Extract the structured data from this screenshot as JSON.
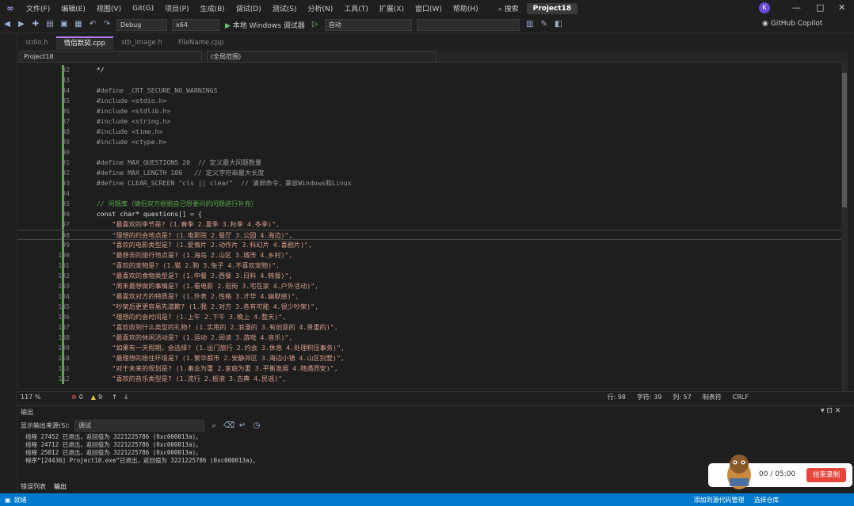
{
  "menu": [
    "文件(F)",
    "编辑(E)",
    "视图(V)",
    "Git(G)",
    "项目(P)",
    "生成(B)",
    "调试(D)",
    "测试(S)",
    "分析(N)",
    "工具(T)",
    "扩展(X)",
    "窗口(W)",
    "帮助(H)"
  ],
  "search_label": "搜索",
  "project_title": "Project18",
  "user_initial": "K",
  "toolbar": {
    "config": "Debug",
    "platform": "x64",
    "run_label": "本地 Windows 调试器",
    "auto": "自动",
    "copilot": "GitHub Copilot"
  },
  "tabs": [
    "stdio.h",
    "情侣默契.cpp",
    "stb_image.h",
    "FileName.cpp"
  ],
  "active_tab": 1,
  "nav": {
    "project": "Project18",
    "scope": "(全局范围)"
  },
  "code_lines": [
    {
      "n": "82",
      "t": "    */"
    },
    {
      "n": "83",
      "t": ""
    },
    {
      "n": "84",
      "t": "    #define _CRT_SECURE_NO_WARNINGS"
    },
    {
      "n": "85",
      "t": "    #include <stdio.h>"
    },
    {
      "n": "86",
      "t": "    #include <stdlib.h>"
    },
    {
      "n": "87",
      "t": "    #include <string.h>"
    },
    {
      "n": "88",
      "t": "    #include <time.h>"
    },
    {
      "n": "89",
      "t": "    #include <ctype.h>"
    },
    {
      "n": "90",
      "t": ""
    },
    {
      "n": "91",
      "t": "    #define MAX_QUESTIONS 20  // 定义最大问题数量"
    },
    {
      "n": "92",
      "t": "    #define MAX_LENGTH 100   // 定义字符串最大长度"
    },
    {
      "n": "93",
      "t": "    #define CLEAR_SCREEN \"cls || clear\"  // 清屏命令，兼容Windows和Linux"
    },
    {
      "n": "94",
      "t": ""
    },
    {
      "n": "95",
      "t": "    // 问题库（情侣双方根据自己想要问的问题进行补充）"
    },
    {
      "n": "96",
      "t": "    const char* questions[] = {"
    },
    {
      "n": "97",
      "t": "        \"最喜欢的季节是? (1.春季 2.夏季 3.秋季 4.冬季)\","
    },
    {
      "n": "98",
      "t": "        \"理想的约会地点是? (1.电影院 2.餐厅 3.公园 4.海边)\","
    },
    {
      "n": "99",
      "t": "        \"喜欢的电影类型是? (1.爱情片 2.动作片 3.科幻片 4.喜剧片)\","
    },
    {
      "n": "100",
      "t": "        \"最想去的旅行地点是? (1.海岛 2.山区 3.城市 4.乡村)\","
    },
    {
      "n": "101",
      "t": "        \"喜欢的宠物是? (1.猫 2.狗 3.兔子 4.不喜欢宠物)\","
    },
    {
      "n": "102",
      "t": "        \"最喜欢的食物类型是? (1.中餐 2.西餐 3.日料 4.韩餐)\","
    },
    {
      "n": "103",
      "t": "        \"周末最想做的事情是? (1.看电影 2.逛街 3.宅在家 4.户外活动)\","
    },
    {
      "n": "104",
      "t": "        \"最喜欢对方的特质是? (1.外表 2.性格 3.才华 4.幽默感)\","
    },
    {
      "n": "105",
      "t": "        \"吵架后更更容易先道歉? (1.我 2.对方 3.各有可能 4.很少吵架)\","
    },
    {
      "n": "106",
      "t": "        \"理想的约会时间是? (1.上午 2.下午 3.晚上 4.整天)\","
    },
    {
      "n": "107",
      "t": "        \"喜欢收到什么类型的礼物? (1.实用的 2.浪漫的 3.有创意的 4.贵重的)\","
    },
    {
      "n": "108",
      "t": "        \"最喜欢的休闲活动是? (1.运动 2.阅读 3.游戏 4.音乐)\","
    },
    {
      "n": "109",
      "t": "        \"如果有一天假期，会选择? (1.出门旅行 2.约会 3.休息 4.处理积压事务)\","
    },
    {
      "n": "110",
      "t": "        \"最理想的居住环境是? (1.繁华都市 2.安静郊区 3.海边小镇 4.山区别墅)\","
    },
    {
      "n": "111",
      "t": "        \"对于未来的规划是? (1.事业为重 2.家庭为重 3.平衡发展 4.随遇而安)\","
    },
    {
      "n": "112",
      "t": "        \"喜欢的音乐类型是? (1.流行 2.摇滚 3.古典 4.民谣)\","
    }
  ],
  "current_line": "98",
  "editor_status": {
    "zoom": "117 %",
    "errors": "0",
    "warnings": "9",
    "line": "行: 98",
    "char": "字符: 39",
    "col": "列: 57",
    "tabs": "制表符",
    "eol": "CRLF"
  },
  "output": {
    "title": "输出",
    "source_label": "显示输出来源(S):",
    "source_value": "调试",
    "lines": [
      "线程 27452 已退出，返回值为 3221225786 (0xc000013a)。",
      "线程 24712 已退出，返回值为 3221225786 (0xc000013a)。",
      "线程 25812 已退出，返回值为 3221225786 (0xc000013a)。",
      "程序“[24436] Project18.exe”已退出，返回值为 3221225786 (0xc000013a)。"
    ]
  },
  "bottom_tabs": [
    "错误列表",
    "输出"
  ],
  "status": {
    "ready": "就绪",
    "add_source": "添加到源代码管理",
    "select_repo": "选择仓库"
  },
  "recorder": {
    "time": "00 / 05:00",
    "stop_label": "结束录制"
  }
}
